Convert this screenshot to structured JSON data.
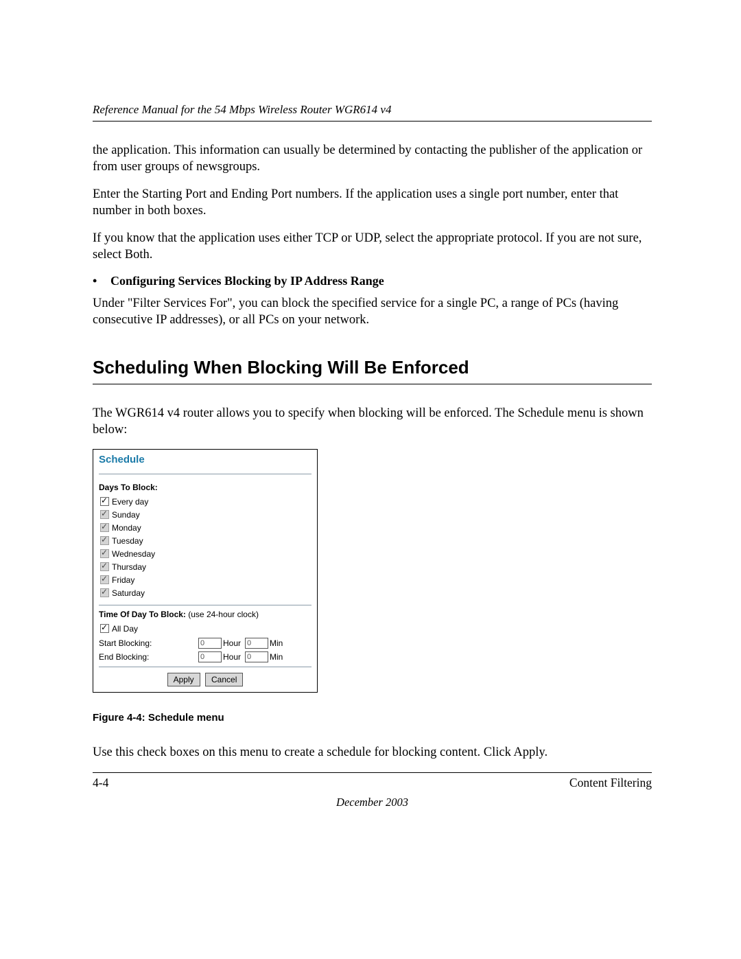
{
  "header": {
    "title": "Reference Manual for the 54 Mbps Wireless Router WGR614 v4"
  },
  "paragraphs": {
    "p1": "the application. This information can usually be determined by contacting the publisher of the application or from user groups of newsgroups.",
    "p2": "Enter the Starting Port and Ending Port numbers. If the application uses a single port number, enter that number in both boxes.",
    "p3": "If you know that the application uses either TCP or UDP, select the appropriate protocol. If you are not sure, select Both.",
    "bullet1": "Configuring Services Blocking by IP Address Range",
    "p4": "Under \"Filter Services For\", you can block the specified service for a single PC, a range of PCs (having consecutive IP addresses), or all PCs on your network.",
    "p5": "The WGR614 v4 router allows you to specify when blocking will be enforced. The Schedule menu is shown below:",
    "p6": "Use this check boxes on this menu to create a schedule for blocking content. Click Apply."
  },
  "section_heading": "Scheduling When Blocking Will Be Enforced",
  "schedule": {
    "title": "Schedule",
    "days_heading": "Days To Block:",
    "days": [
      {
        "label": "Every day",
        "checked": true,
        "disabled": false
      },
      {
        "label": "Sunday",
        "checked": true,
        "disabled": true
      },
      {
        "label": "Monday",
        "checked": true,
        "disabled": true
      },
      {
        "label": "Tuesday",
        "checked": true,
        "disabled": true
      },
      {
        "label": "Wednesday",
        "checked": true,
        "disabled": true
      },
      {
        "label": "Thursday",
        "checked": true,
        "disabled": true
      },
      {
        "label": "Friday",
        "checked": true,
        "disabled": true
      },
      {
        "label": "Saturday",
        "checked": true,
        "disabled": true
      }
    ],
    "time_heading": "Time Of Day To Block:",
    "time_sub": "(use 24-hour clock)",
    "all_day_label": "All Day",
    "all_day_checked": true,
    "start_label": "Start Blocking:",
    "end_label": "End Blocking:",
    "hour_unit": "Hour",
    "min_unit": "Min",
    "start_hour": "0",
    "start_min": "0",
    "end_hour": "0",
    "end_min": "0",
    "apply_label": "Apply",
    "cancel_label": "Cancel"
  },
  "figure_caption": "Figure 4-4:  Schedule menu",
  "footer": {
    "page_num": "4-4",
    "section": "Content Filtering",
    "date": "December 2003"
  }
}
